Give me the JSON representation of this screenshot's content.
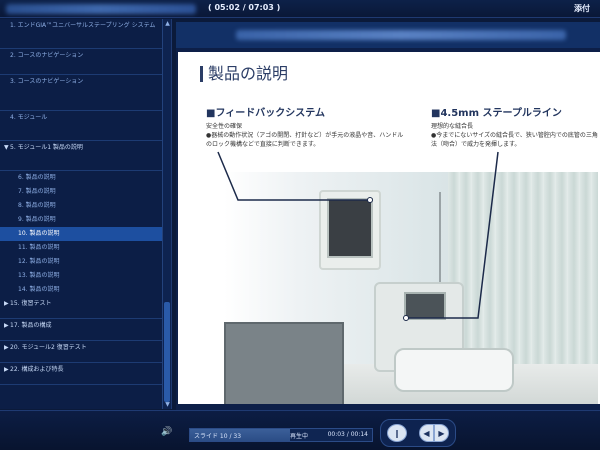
{
  "header": {
    "time": "( 05:02 / 07:03 )",
    "attachments": "添付"
  },
  "sidebar": {
    "items": [
      {
        "label": "1. エンドGIA™ユニバーサルステープリング システム",
        "type": "top"
      },
      {
        "label": "2. コースのナビゲーション",
        "type": "top"
      },
      {
        "label": "3. コースのナビゲーション",
        "type": "top"
      },
      {
        "label": "4. モジュール",
        "type": "top"
      },
      {
        "label": "5. モジュール1 製品の説明",
        "type": "top-expanded"
      },
      {
        "label": "6. 製品の説明",
        "type": "sub"
      },
      {
        "label": "7. 製品の説明",
        "type": "sub"
      },
      {
        "label": "8. 製品の説明",
        "type": "sub"
      },
      {
        "label": "9. 製品の説明",
        "type": "sub"
      },
      {
        "label": "10. 製品の説明",
        "type": "sub-active"
      },
      {
        "label": "11. 製品の説明",
        "type": "sub"
      },
      {
        "label": "12. 製品の説明",
        "type": "sub"
      },
      {
        "label": "13. 製品の説明",
        "type": "sub"
      },
      {
        "label": "14. 製品の説明",
        "type": "sub"
      },
      {
        "label": "15. 復習テスト",
        "type": "top-collapsed"
      },
      {
        "label": "17. 製品の構成",
        "type": "top-collapsed"
      },
      {
        "label": "20. モジュール2 復習テスト",
        "type": "top-collapsed"
      },
      {
        "label": "22. 構成および特長",
        "type": "top-collapsed"
      }
    ]
  },
  "slide": {
    "title": "製品の説明",
    "section1": {
      "heading": "■フィードバックシステム",
      "subheading": "安全性の確保",
      "desc": "●器械の動作状況（アゴの開閉、打針など）が手元の液晶や音、ハンドルのロック機構などで直接に判断できます。"
    },
    "section2": {
      "heading": "■4.5mm ステープルライン",
      "subheading": "理想的な縫合長",
      "desc": "●今までにないサイズの縫合長で、狭い管腔内での底管の三角法（吻合）で威力を発揮します。"
    }
  },
  "player": {
    "slide_count": "スライド 10 / 33",
    "status": "再生中",
    "time": "00:03 / 00:14",
    "progress": 0.55,
    "play_icon": "‖",
    "prev_icon": "◀",
    "next_icon": "▶"
  },
  "colors": {
    "bg": "#0b1a3a",
    "accent": "#1d4fa0",
    "title": "#2b3d66"
  }
}
